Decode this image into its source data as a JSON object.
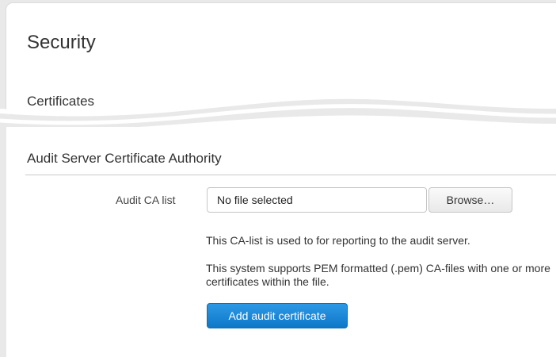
{
  "page": {
    "title": "Security",
    "section_label": "Certificates"
  },
  "audit": {
    "title": "Audit Server Certificate Authority",
    "field_label": "Audit CA list",
    "file_value": "No file selected",
    "browse_label": "Browse…",
    "help_text_1": "This CA-list is used to for reporting to the audit server.",
    "help_text_2": "This system supports PEM formatted (.pem) CA-files with one or more certificates within the file.",
    "add_button_label": "Add audit certificate"
  },
  "colors": {
    "primary_button": "#0e78c8",
    "background": "#e9e9e9"
  }
}
